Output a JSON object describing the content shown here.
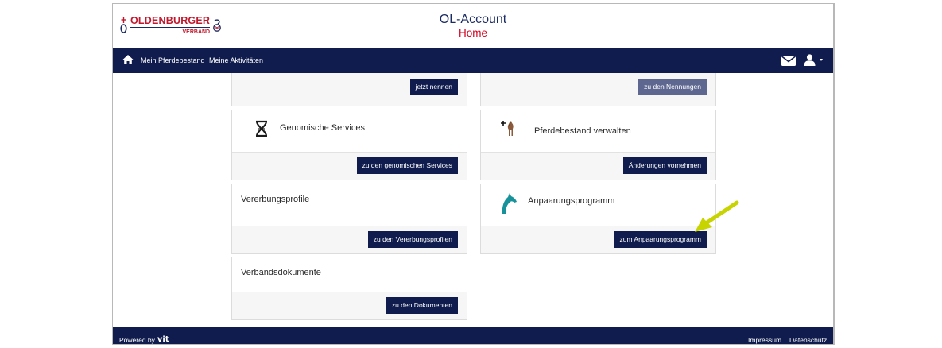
{
  "header": {
    "logo_main": "OLDENBURGER",
    "logo_sub": "VERBAND",
    "title": "OL-Account",
    "subtitle": "Home"
  },
  "nav": {
    "items": [
      {
        "label": "Mein Pferdebestand"
      },
      {
        "label": "Meine Aktivitäten"
      }
    ],
    "icons": [
      "home-icon",
      "mail-icon",
      "user-icon"
    ]
  },
  "cards": {
    "top_left_button": "jetzt nennen",
    "top_right_button": "zu den Nennungen",
    "genomic": {
      "title": "Genomische Services",
      "button": "zu den genomischen Services"
    },
    "horses": {
      "title": "Pferdebestand verwalten",
      "button": "Änderungen vornehmen"
    },
    "heredity": {
      "title": "Vererbungsprofile",
      "button": "zu den Vererbungsprofilen"
    },
    "mating": {
      "title": "Anpaarungsprogramm",
      "button": "zum Anpaarungsprogramm"
    },
    "documents": {
      "title": "Verbandsdokumente",
      "button": "zu den Dokumenten"
    }
  },
  "footer": {
    "powered_by": "Powered by",
    "brand": "vit",
    "impressum": "Impressum",
    "datenschutz": "Datenschutz"
  },
  "colors": {
    "navy": "#0f1c4d",
    "red": "#d2001e",
    "arrow": "#c8d400"
  }
}
